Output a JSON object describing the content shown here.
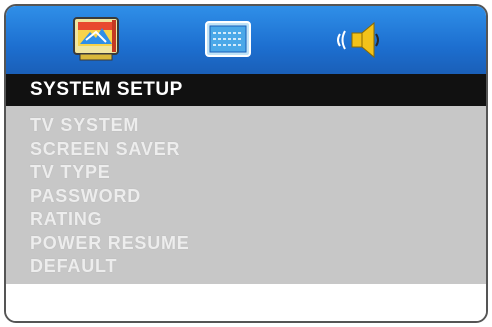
{
  "tabs": [
    {
      "icon": "system-setup-icon",
      "selected": true
    },
    {
      "icon": "display-setup-icon",
      "selected": false
    },
    {
      "icon": "audio-setup-icon",
      "selected": false
    }
  ],
  "header": {
    "title": "SYSTEM  SETUP"
  },
  "menu": {
    "items": [
      {
        "label": "TV SYSTEM"
      },
      {
        "label": "SCREEN SAVER"
      },
      {
        "label": "TV TYPE"
      },
      {
        "label": "PASSWORD"
      },
      {
        "label": "RATING"
      },
      {
        "label": "POWER RESUME"
      },
      {
        "label": "DEFAULT"
      }
    ]
  },
  "colors": {
    "top_bar": "#1d6fd0",
    "header_bg": "#111111",
    "menu_bg": "#c7c7c7",
    "menu_text": "#ededed"
  }
}
